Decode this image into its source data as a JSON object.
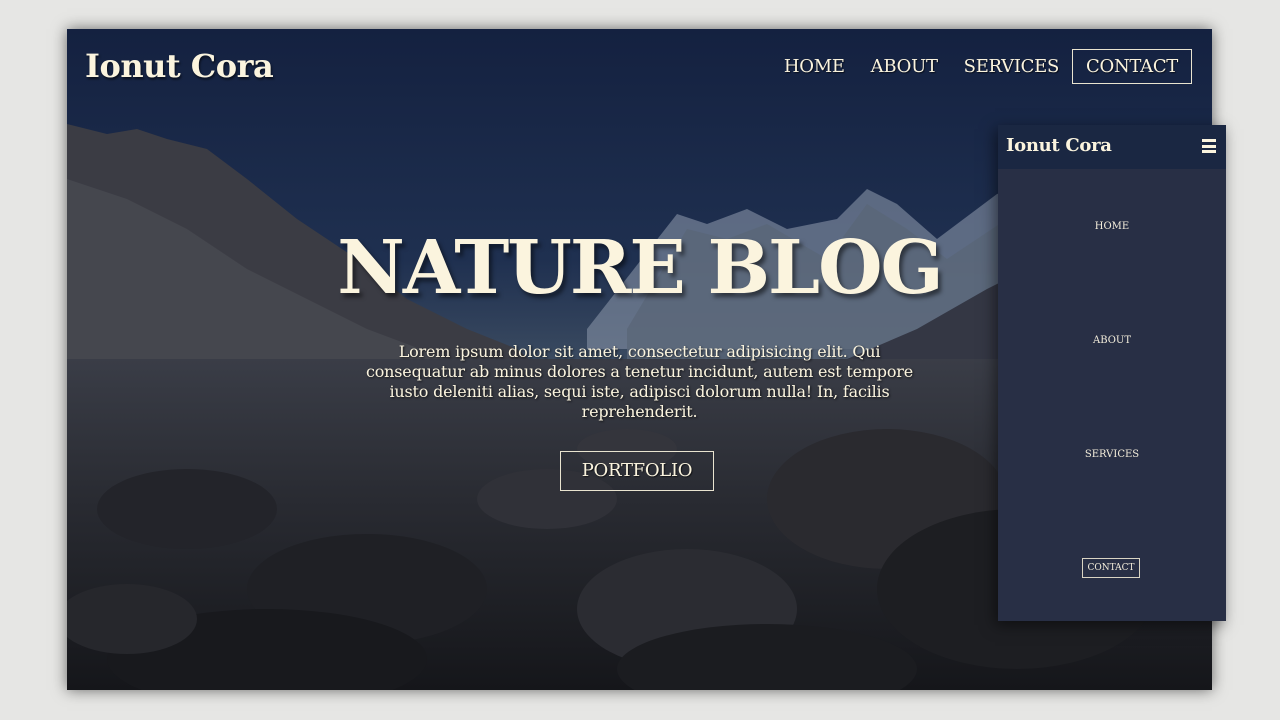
{
  "desktop": {
    "brand": "Ionut Cora",
    "nav": [
      "HOME",
      "ABOUT",
      "SERVICES",
      "CONTACT"
    ],
    "hero_title": "NATURE BLOG",
    "hero_text": "Lorem ipsum dolor sit amet, consectetur adipisicing elit. Qui consequatur ab minus dolores a tenetur incidunt, autem est tempore iusto deleniti alias, sequi iste, adipisci dolorum nulla! In, facilis reprehenderit.",
    "cta": "PORTFOLIO"
  },
  "mobile": {
    "brand": "Ionut Cora",
    "menu_icon": "hamburger-menu-icon",
    "nav": [
      "HOME",
      "ABOUT",
      "SERVICES",
      "CONTACT"
    ]
  },
  "colors": {
    "text": "#fbf4de",
    "hero_sky": "#16233f",
    "mobile_panel": "#282f45",
    "mobile_header": "#1a2742"
  }
}
